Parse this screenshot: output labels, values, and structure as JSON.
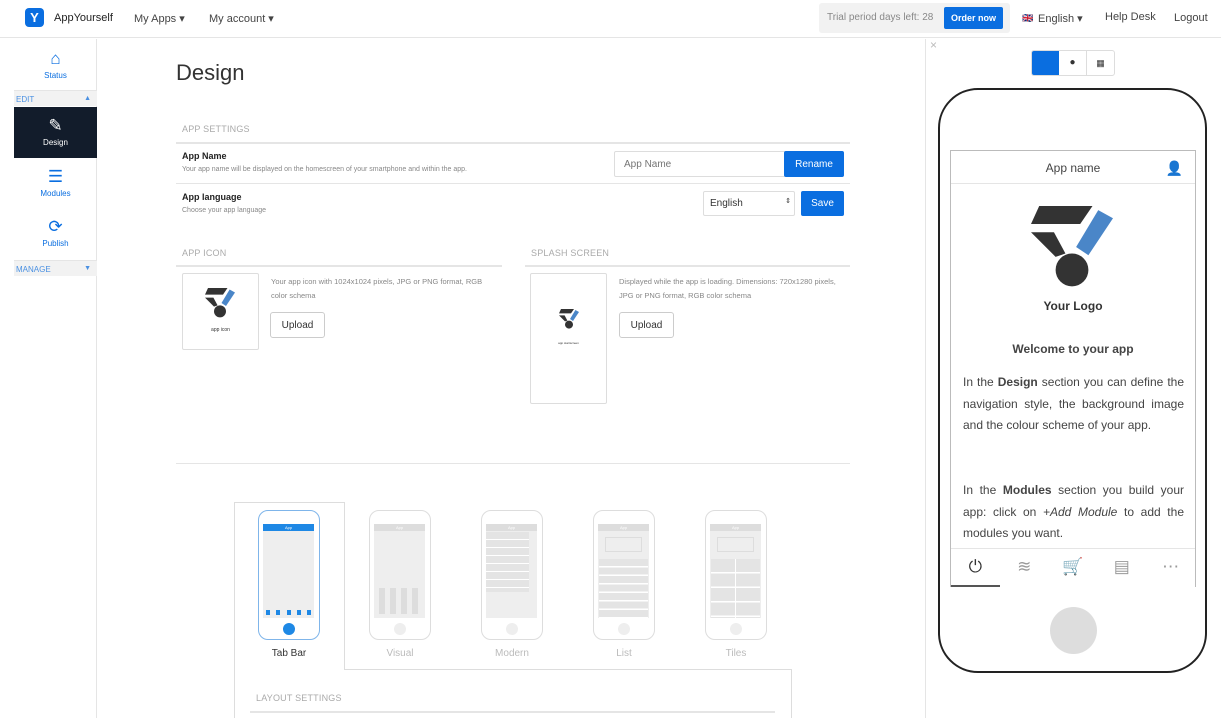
{
  "topbar": {
    "brand": "AppYourself",
    "my_apps": "My Apps ▾",
    "my_account": "My account ▾",
    "trial": "Trial period days left: 28",
    "order": "Order now",
    "language": "English ▾",
    "help": "Help Desk",
    "logout": "Logout"
  },
  "sidebar": {
    "status": "Status",
    "edit": "EDIT",
    "design": "Design",
    "modules": "Modules",
    "publish": "Publish",
    "manage": "MANAGE"
  },
  "main": {
    "title": "Design",
    "app_settings": "APP SETTINGS",
    "app_name": {
      "label": "App Name",
      "desc": "Your app name will be displayed on the homescreen of your smartphone and within the app.",
      "placeholder": "App Name",
      "button": "Rename"
    },
    "app_language": {
      "label": "App language",
      "desc": "Choose your app language",
      "value": "English",
      "button": "Save"
    },
    "app_icon": {
      "title": "APP ICON",
      "desc": "Your app icon with 1024x1024 pixels, JPG or PNG format, RGB color schema",
      "caption": "app icon",
      "button": "Upload"
    },
    "splash": {
      "title": "SPLASH SCREEN",
      "desc": "Displayed while the app is loading. Dimensions: 720x1280 pixels, JPG or PNG format, RGB color schema",
      "caption": "app startscreen",
      "button": "Upload"
    },
    "layouts": [
      {
        "label": "Tab Bar",
        "selected": true
      },
      {
        "label": "Visual"
      },
      {
        "label": "Modern"
      },
      {
        "label": "List"
      },
      {
        "label": "Tiles"
      }
    ],
    "thumb_header": "App",
    "layout_settings": "LAYOUT SETTINGS"
  },
  "preview": {
    "close": "×",
    "app_name": "App name",
    "logo_text": "Your Logo",
    "welcome": "Welcome to your app",
    "p1": {
      "a": "In the ",
      "b": "Design",
      "c": " section you can define the navigation style, the background image and the colour scheme of your app."
    },
    "p2": {
      "a": "In the ",
      "b": "Modules",
      "c": " section you build your app: click on ",
      "i": "+Add Module",
      "d": " to add the modules you want."
    }
  },
  "colors": {
    "accent": "#0a6ee0",
    "sidebar_active": "#121c2b",
    "logo_blue": "#4a86c8"
  }
}
